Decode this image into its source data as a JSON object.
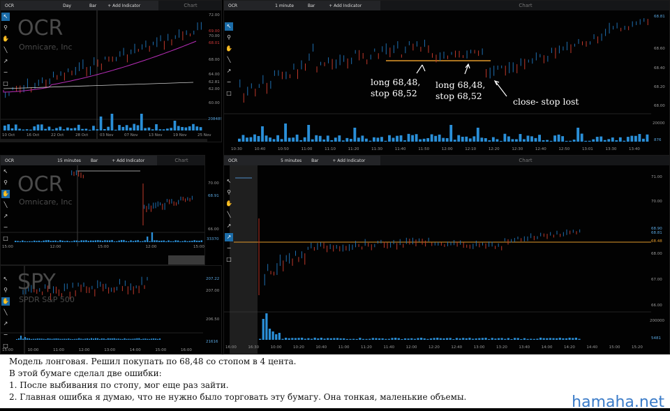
{
  "panels": {
    "daily": {
      "symbol": "OCR",
      "interval": "Day",
      "type": "Bar",
      "add_indicator": "+ Add Indicator",
      "chart_label": "Chart",
      "watermark": "OCR",
      "company": "Omnicare, Inc",
      "y_ticks": [
        "72.00",
        "70.00",
        "68.00",
        "66.00",
        "64.00",
        "62.81",
        "62.00",
        "60.00"
      ],
      "tags": [
        "69.00",
        "68.01"
      ],
      "volume_tag": "2084896",
      "x_ticks": [
        "10 Oct",
        "16 Oct",
        "22 Oct",
        "28 Oct",
        "03 Nov",
        "07 Nov",
        "13 Nov",
        "19 Nov",
        "25 Nov"
      ]
    },
    "oneminute": {
      "symbol": "OCR",
      "interval": "1 minute",
      "type": "Bar",
      "add_indicator": "+ Add Indicator",
      "chart_label": "Chart",
      "y_ticks": [
        "68.60",
        "68.40",
        "68.20",
        "68.00"
      ],
      "tags": [
        "68.81"
      ],
      "volume_ticks": [
        "20000"
      ],
      "volume_tag": "876",
      "x_ticks": [
        "10:30",
        "10:40",
        "10:50",
        "11:00",
        "11:10",
        "11:20",
        "11:30",
        "11:40",
        "11:50",
        "12:00",
        "12:10",
        "12:20",
        "12:30",
        "12:40",
        "12:50",
        "13:01",
        "13:30",
        "13:40"
      ]
    },
    "fifteen": {
      "symbol": "OCR",
      "interval": "15 minutes",
      "type": "Bar",
      "add_indicator": "+ Add Indicator",
      "chart_label": "Chart",
      "watermark": "OCR",
      "company": "Omnicare, Inc",
      "y_ticks": [
        "70.00",
        "68.00",
        "66.00"
      ],
      "tags": [
        "68.91"
      ],
      "volume_tag": "33370",
      "x_ticks": [
        "15:00",
        "12:00",
        "15:00",
        "12:00",
        "15:00"
      ]
    },
    "spy": {
      "watermark": "SPY",
      "company": "SPDR S&P 500",
      "y_ticks": [
        "207.00",
        "206.50"
      ],
      "tags": [
        "207.22"
      ],
      "volume_tag": "21616",
      "x_ticks": [
        "15:00",
        "10:00",
        "11:00",
        "12:00",
        "13:00",
        "14:00",
        "15:00",
        "16:00"
      ]
    },
    "fiveminute": {
      "symbol": "OCR",
      "interval": "5 minutes",
      "type": "Bar",
      "add_indicator": "+ Add Indicator",
      "chart_label": "Chart",
      "y_ticks": [
        "71.00",
        "70.00",
        "69.00",
        "68.00",
        "67.00",
        "66.00"
      ],
      "tags": [
        "68.48",
        "68.81",
        "68.90"
      ],
      "volume_ticks": [
        "200000"
      ],
      "volume_tag": "5481",
      "x_ticks": [
        "16:00",
        "16:30",
        "10:00",
        "10:20",
        "10:40",
        "11:00",
        "11:20",
        "11:40",
        "12:00",
        "12:20",
        "12:40",
        "13:00",
        "13:20",
        "13:40",
        "14:00",
        "14:20",
        "14:40",
        "15:00",
        "15:20"
      ]
    }
  },
  "annotations": {
    "long1": [
      "long 68,48,",
      "stop 68,52"
    ],
    "long2": [
      "long 68,48,",
      "stop 68,52"
    ],
    "close": "close- stop lost"
  },
  "caption": [
    "Модель лонговая. Решил покупать по 68,48 со стопом в 4 цента.",
    "В этой бумаге сделал две ошибки:",
    "1.  После выбивания по стопу, мог еще раз зайти.",
    "2.  Главная ошибка я думаю, что не нужно было торговать эту бумагу. Она тонкая, маленькие объемы."
  ],
  "brand": "hamaha.net",
  "colors": {
    "up": "#1e6fb0",
    "down": "#c0392b",
    "accent": "#e39a2b",
    "ma_fast": "#b82eb8",
    "ma_slow": "#cfcfcf",
    "volume": "#2a8fd8",
    "selected_tool": "#1b6ca8"
  },
  "tool_icons": [
    "pointer-icon",
    "zoom-icon",
    "hand-icon",
    "line-icon",
    "arrow-icon",
    "minus-icon",
    "square-icon"
  ]
}
